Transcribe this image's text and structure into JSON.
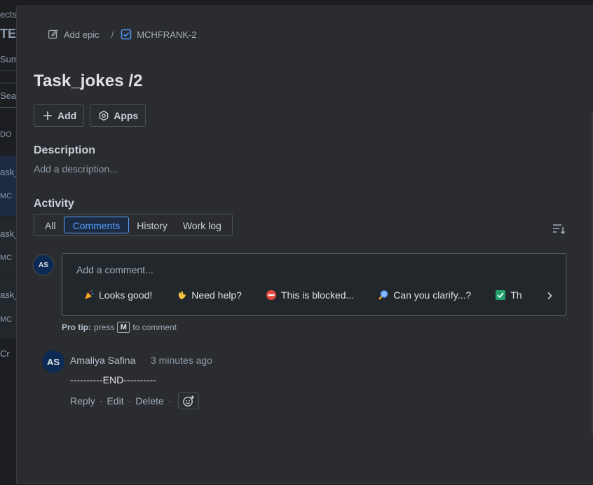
{
  "background": {
    "frag_projects": "ects",
    "frag_title": "TES",
    "frag_summary": "Sum",
    "frag_search": "Sea",
    "frag_todo": "DO",
    "rows": [
      {
        "title": "ask_",
        "key": "MC"
      },
      {
        "title": "ask_",
        "key": "MC"
      },
      {
        "title": "ask_",
        "key": "MC"
      }
    ],
    "frag_create": "Cr"
  },
  "breadcrumbs": {
    "add_epic": "Add epic",
    "separator": "/",
    "issue_key": "MCHFRANK-2"
  },
  "issue": {
    "title": "Task_jokes /2"
  },
  "actions": {
    "add_label": "Add",
    "apps_label": "Apps"
  },
  "description": {
    "heading": "Description",
    "placeholder": "Add a description..."
  },
  "activity": {
    "heading": "Activity",
    "tabs": [
      "All",
      "Comments",
      "History",
      "Work log"
    ],
    "active_tab": "Comments"
  },
  "composer": {
    "avatar_initials": "AS",
    "placeholder": "Add a comment...",
    "quick_replies": [
      {
        "icon": "party-popper-icon",
        "label": "Looks good!"
      },
      {
        "icon": "waving-hand-icon",
        "label": "Need help?"
      },
      {
        "icon": "no-entry-icon",
        "label": "This is blocked..."
      },
      {
        "icon": "magnifying-glass-icon",
        "label": "Can you clarify...?"
      },
      {
        "icon": "check-box-icon",
        "label": "Th"
      }
    ],
    "protip_prefix": "Pro tip:",
    "protip_press": "press",
    "protip_key": "M",
    "protip_suffix": "to comment"
  },
  "comments": [
    {
      "avatar_initials": "AS",
      "author": "Amaliya Safina",
      "time": "3 minutes ago",
      "body": "----------END----------",
      "reply_label": "Reply",
      "edit_label": "Edit",
      "delete_label": "Delete"
    }
  ],
  "colors": {
    "accent": "#579dff",
    "modal_bg": "#2b2c2f",
    "avatar_bg": "#0c2a54"
  }
}
